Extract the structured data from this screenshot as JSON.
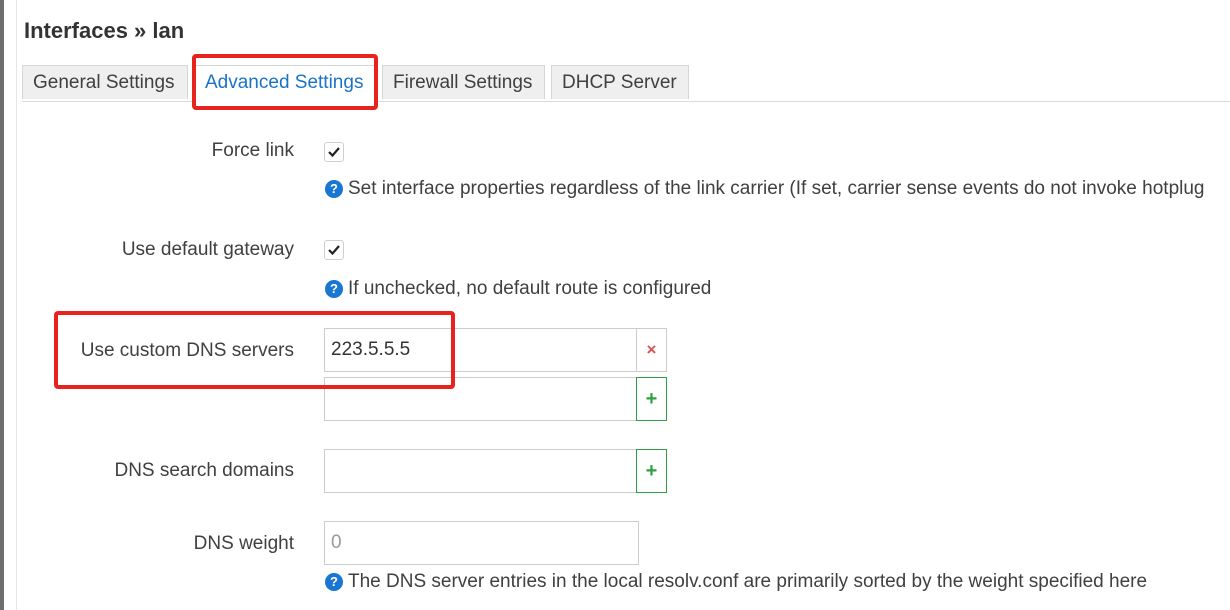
{
  "page": {
    "title": "Interfaces » lan"
  },
  "tabs": [
    {
      "label": "General Settings"
    },
    {
      "label": "Advanced Settings"
    },
    {
      "label": "Firewall Settings"
    },
    {
      "label": "DHCP Server"
    }
  ],
  "active_tab": "Advanced Settings",
  "fields": {
    "force_link": {
      "label": "Force link",
      "checked": true,
      "help": "Set interface properties regardless of the link carrier (If set, carrier sense events do not invoke hotplug"
    },
    "default_gateway": {
      "label": "Use default gateway",
      "checked": true,
      "help": "If unchecked, no default route is configured"
    },
    "custom_dns": {
      "label": "Use custom DNS servers",
      "entries": [
        "223.5.5.5",
        ""
      ],
      "remove_symbol": "×",
      "add_symbol": "+"
    },
    "dns_search": {
      "label": "DNS search domains",
      "value": "",
      "add_symbol": "+"
    },
    "dns_weight": {
      "label": "DNS weight",
      "placeholder": "0",
      "help": "The DNS server entries in the local resolv.conf are primarily sorted by the weight specified here"
    }
  },
  "icons": {
    "help": "?"
  },
  "colors": {
    "accent": "#1a73c8",
    "highlight": "#e8231e",
    "add": "#2ea043",
    "remove": "#d9534f",
    "help_icon": "#1976d2"
  }
}
